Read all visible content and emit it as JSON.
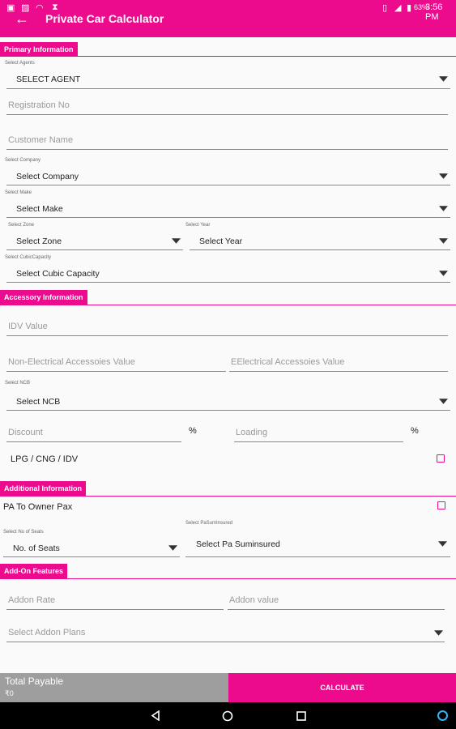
{
  "status_bar": {
    "battery": "63%",
    "time": "3:56 PM"
  },
  "app_bar": {
    "title": "Private Car Calculator"
  },
  "primary": {
    "header": "Primary Information",
    "agent": {
      "label": "Select Agents",
      "value": "SELECT AGENT"
    },
    "registration_placeholder": "Registration No",
    "customer_placeholder": "Customer Name",
    "company": {
      "label": "Select Company",
      "value": "Select Company"
    },
    "make": {
      "label": "Select Make",
      "value": "Select Make"
    },
    "zone": {
      "label": "Select Zone",
      "value": "Select Zone"
    },
    "year": {
      "label": "Select Year",
      "value": "Select Year"
    },
    "cubic": {
      "label": "Select CubicCapacity",
      "value": "Select Cubic Capacity"
    }
  },
  "accessory": {
    "header": "Accessory Information",
    "idv_placeholder": "IDV Value",
    "non_electrical_placeholder": "Non-Electrical Accessoies Value",
    "electrical_placeholder": "EElectrical Accessoies Value",
    "ncb": {
      "label": "Select NCB",
      "value": "Select NCB"
    },
    "discount_placeholder": "Discount",
    "loading_placeholder": "Loading",
    "percent": "%",
    "lpg_label": "LPG / CNG / IDV"
  },
  "additional": {
    "header": "Additional Information",
    "pa_owner_label": "PA To Owner Pax",
    "seats": {
      "label": "Select No of Seats",
      "value": "No. of Seats"
    },
    "pa_sum": {
      "label": "Select PaSumInsured",
      "value": "Select Pa Suminsured"
    }
  },
  "addon": {
    "header": "Add-On Features",
    "rate_placeholder": "Addon Rate",
    "value_placeholder": "Addon value",
    "plans_placeholder": "Select Addon Plans"
  },
  "footer": {
    "total_label": "Total Payable",
    "total_value": "₹0",
    "calculate_label": "CALCULATE"
  }
}
